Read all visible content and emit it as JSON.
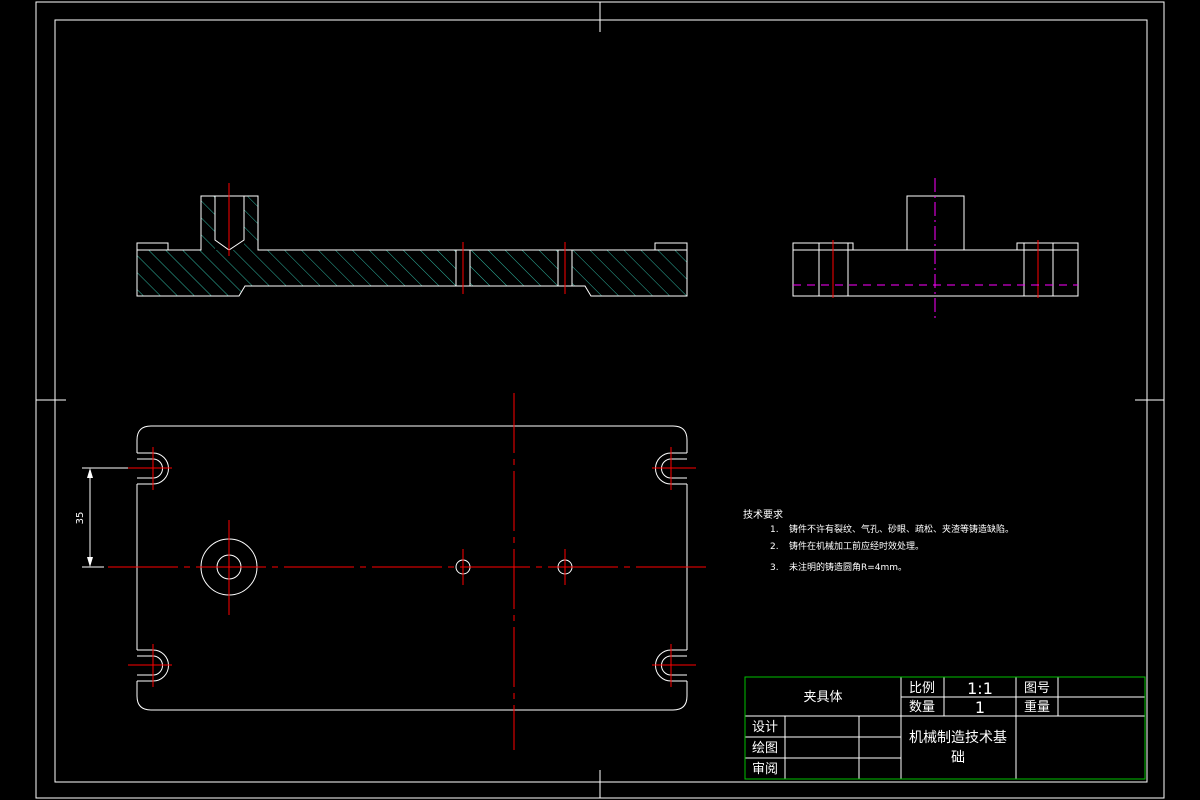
{
  "drawing": {
    "dimension_value": "35",
    "tech_requirements": {
      "heading": "技术要求",
      "items": [
        {
          "num": "1.",
          "text": "铸件不许有裂纹、气孔、砂眼、疏松、夹渣等铸造缺陷。"
        },
        {
          "num": "2.",
          "text": "铸件在机械加工前应经时效处理。"
        },
        {
          "num": "3.",
          "text": "未注明的铸造圆角R=4mm。"
        }
      ]
    },
    "title_block": {
      "part_name": "夹具体",
      "scale_label": "比例",
      "scale_value": "1:1",
      "drawing_no_label": "图号",
      "quantity_label": "数量",
      "quantity_value": "1",
      "weight_label": "重量",
      "design_label": "设计",
      "drafting_label": "绘图",
      "review_label": "审阅",
      "school_line1": "机械制造技术基",
      "school_line2": "础"
    },
    "colors": {
      "background": "#000000",
      "outline": "#ffffff",
      "centerline": "#ff0000",
      "hatch": "#2fb5a0",
      "hidden_line": "#ff00ff",
      "title_border": "#00c000"
    }
  }
}
